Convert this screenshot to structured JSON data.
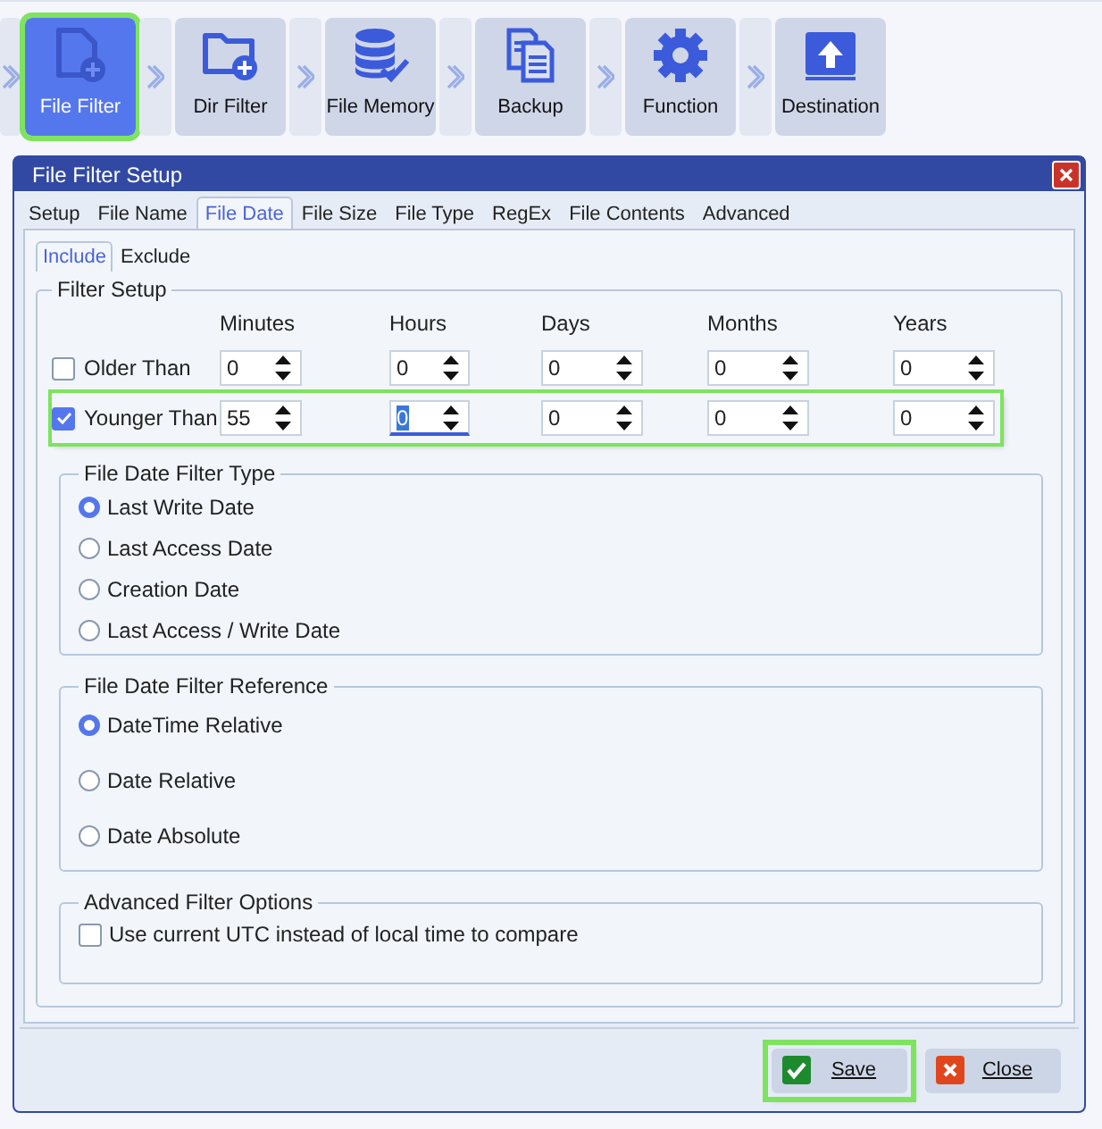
{
  "toolbar": {
    "steps": [
      {
        "label": "File Filter",
        "kind": "file",
        "selected": true,
        "highlighted": true
      },
      {
        "label": "Dir Filter",
        "kind": "folder",
        "selected": false,
        "highlighted": false
      },
      {
        "label": "File Memory",
        "kind": "database",
        "selected": false,
        "highlighted": false
      },
      {
        "label": "Backup",
        "kind": "copy",
        "selected": false,
        "highlighted": false
      },
      {
        "label": "Function",
        "kind": "gear",
        "selected": false,
        "highlighted": false
      },
      {
        "label": "Destination",
        "kind": "upload",
        "selected": false,
        "highlighted": false
      }
    ]
  },
  "dialog": {
    "title": "File Filter Setup",
    "tabs": [
      {
        "label": "Setup",
        "selected": false
      },
      {
        "label": "File Name",
        "selected": false
      },
      {
        "label": "File Date",
        "selected": true
      },
      {
        "label": "File Size",
        "selected": false
      },
      {
        "label": "File Type",
        "selected": false
      },
      {
        "label": "RegEx",
        "selected": false
      },
      {
        "label": "File Contents",
        "selected": false
      },
      {
        "label": "Advanced",
        "selected": false
      }
    ],
    "subtabs": [
      {
        "label": "Include",
        "selected": true
      },
      {
        "label": "Exclude",
        "selected": false
      }
    ],
    "filter_setup": {
      "title": "Filter Setup",
      "columns": [
        "Minutes",
        "Hours",
        "Days",
        "Months",
        "Years"
      ],
      "rows": [
        {
          "label": "Older Than",
          "checked": false,
          "highlighted": false,
          "values": [
            {
              "value": "0",
              "focused": false
            },
            {
              "value": "0",
              "focused": false
            },
            {
              "value": "0",
              "focused": false
            },
            {
              "value": "0",
              "focused": false
            },
            {
              "value": "0",
              "focused": false
            }
          ]
        },
        {
          "label": "Younger Than",
          "checked": true,
          "highlighted": true,
          "values": [
            {
              "value": "55",
              "focused": false
            },
            {
              "value": "0",
              "focused": true
            },
            {
              "value": "0",
              "focused": false
            },
            {
              "value": "0",
              "focused": false
            },
            {
              "value": "0",
              "focused": false
            }
          ]
        }
      ]
    },
    "date_type": {
      "title": "File Date Filter Type",
      "options": [
        {
          "label": "Last Write Date",
          "selected": true
        },
        {
          "label": "Last Access Date",
          "selected": false
        },
        {
          "label": "Creation Date",
          "selected": false
        },
        {
          "label": "Last Access / Write Date",
          "selected": false
        }
      ]
    },
    "date_reference": {
      "title": "File Date Filter Reference",
      "options": [
        {
          "label": "DateTime Relative",
          "selected": true
        },
        {
          "label": "Date Relative",
          "selected": false
        },
        {
          "label": "Date Absolute",
          "selected": false
        }
      ]
    },
    "advanced": {
      "title": "Advanced Filter Options",
      "options": [
        {
          "label": "Use current UTC instead of local time to compare",
          "checked": false
        }
      ]
    },
    "buttons": [
      {
        "label": "Save",
        "kind": "save",
        "highlighted": true
      },
      {
        "label": "Close",
        "kind": "close",
        "highlighted": false
      }
    ]
  }
}
